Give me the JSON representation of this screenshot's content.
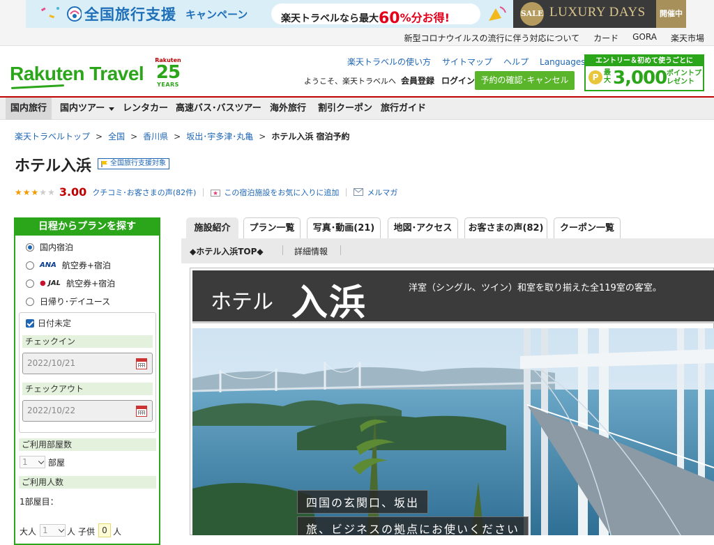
{
  "banner": {
    "campaign_title": "全国旅行支援",
    "campaign_word": "キャンペーン",
    "pill_prefix": "楽天トラベルなら最大",
    "pill_percent": "60",
    "pill_suffix": "%分お得!",
    "sale_circle": "SALE",
    "luxury": "LUXURY DAYS",
    "open_badge": "開催中"
  },
  "util_links": [
    "新型コロナウイルスの流行に伴う対応について",
    "カード",
    "GORA",
    "楽天市場"
  ],
  "header": {
    "logo": "Rakuten Travel",
    "anniv_brand": "Rakuten",
    "anniv_num": "25",
    "anniv_years": "YEARS",
    "links": [
      "楽天トラベルの使い方",
      "サイトマップ",
      "ヘルプ"
    ],
    "languages": "Languages",
    "welcome": "ようこそ、楽天トラベルへ",
    "member": "会員登録",
    "login": "ログイン",
    "reserve_btn": "予約の確認･キャンセル",
    "entry_top": "エントリー＆初めて使うごとに",
    "entry_coin": "P",
    "entry_max": "最大",
    "entry_points": "3,000",
    "entry_pts_label": "ポイントプレゼント"
  },
  "nav": [
    "国内旅行",
    "国内ツアー",
    "レンタカー",
    "高速バス･バスツアー",
    "海外旅行",
    "割引クーポン",
    "旅行ガイド"
  ],
  "breadcrumb": {
    "items": [
      "楽天トラベルトップ",
      "全国",
      "香川県",
      "坂出･宇多津･丸亀"
    ],
    "current": "ホテル入浜 宿泊予約",
    "separator": ">"
  },
  "hotel": {
    "name": "ホテル入浜",
    "support_badge": "全国旅行支援対象",
    "rating": 3.0,
    "score_text": "3.00",
    "reviews_link": "クチコミ･お客さまの声(82件)",
    "fav_link": "この宿泊施設をお気に入りに追加",
    "mail_link": "メルマガ"
  },
  "sidebar": {
    "title": "日程からプランを探す",
    "options": {
      "domestic": "国内宿泊",
      "ana_logo": "ANA",
      "ana": "航空券+宿泊",
      "jal_logo": "JAL",
      "jal": "航空券+宿泊",
      "day": "日帰り･デイユース"
    },
    "date_undecided": "日付未定",
    "checkin_label": "チェックイン",
    "checkin_value": "2022/10/21",
    "checkout_label": "チェックアウト",
    "checkout_value": "2022/10/22",
    "rooms_label": "ご利用部屋数",
    "rooms_value": "1",
    "rooms_unit": "部屋",
    "people_label": "ご利用人数",
    "room1_label": "1部屋目：",
    "adult_label": "大人",
    "adult_value": "1",
    "adult_unit": "人",
    "child_label": "子供",
    "child_value": "0",
    "child_unit": "人"
  },
  "tabs": [
    "施設紹介",
    "プラン一覧",
    "写真･動画(21)",
    "地図･アクセス",
    "お客さまの声(82)",
    "クーポン一覧"
  ],
  "subnav": {
    "top": "◆ホテル入浜TOP◆",
    "detail": "詳細情報"
  },
  "hero": {
    "logo_small": "ホテル",
    "logo_big": "入浜",
    "description": "洋室（シングル、ツイン）和室を取り揃えた全119室の客室。",
    "caption1": "四国の玄関口、坂出",
    "caption2": "旅、ビジネスの拠点にお使いください"
  }
}
